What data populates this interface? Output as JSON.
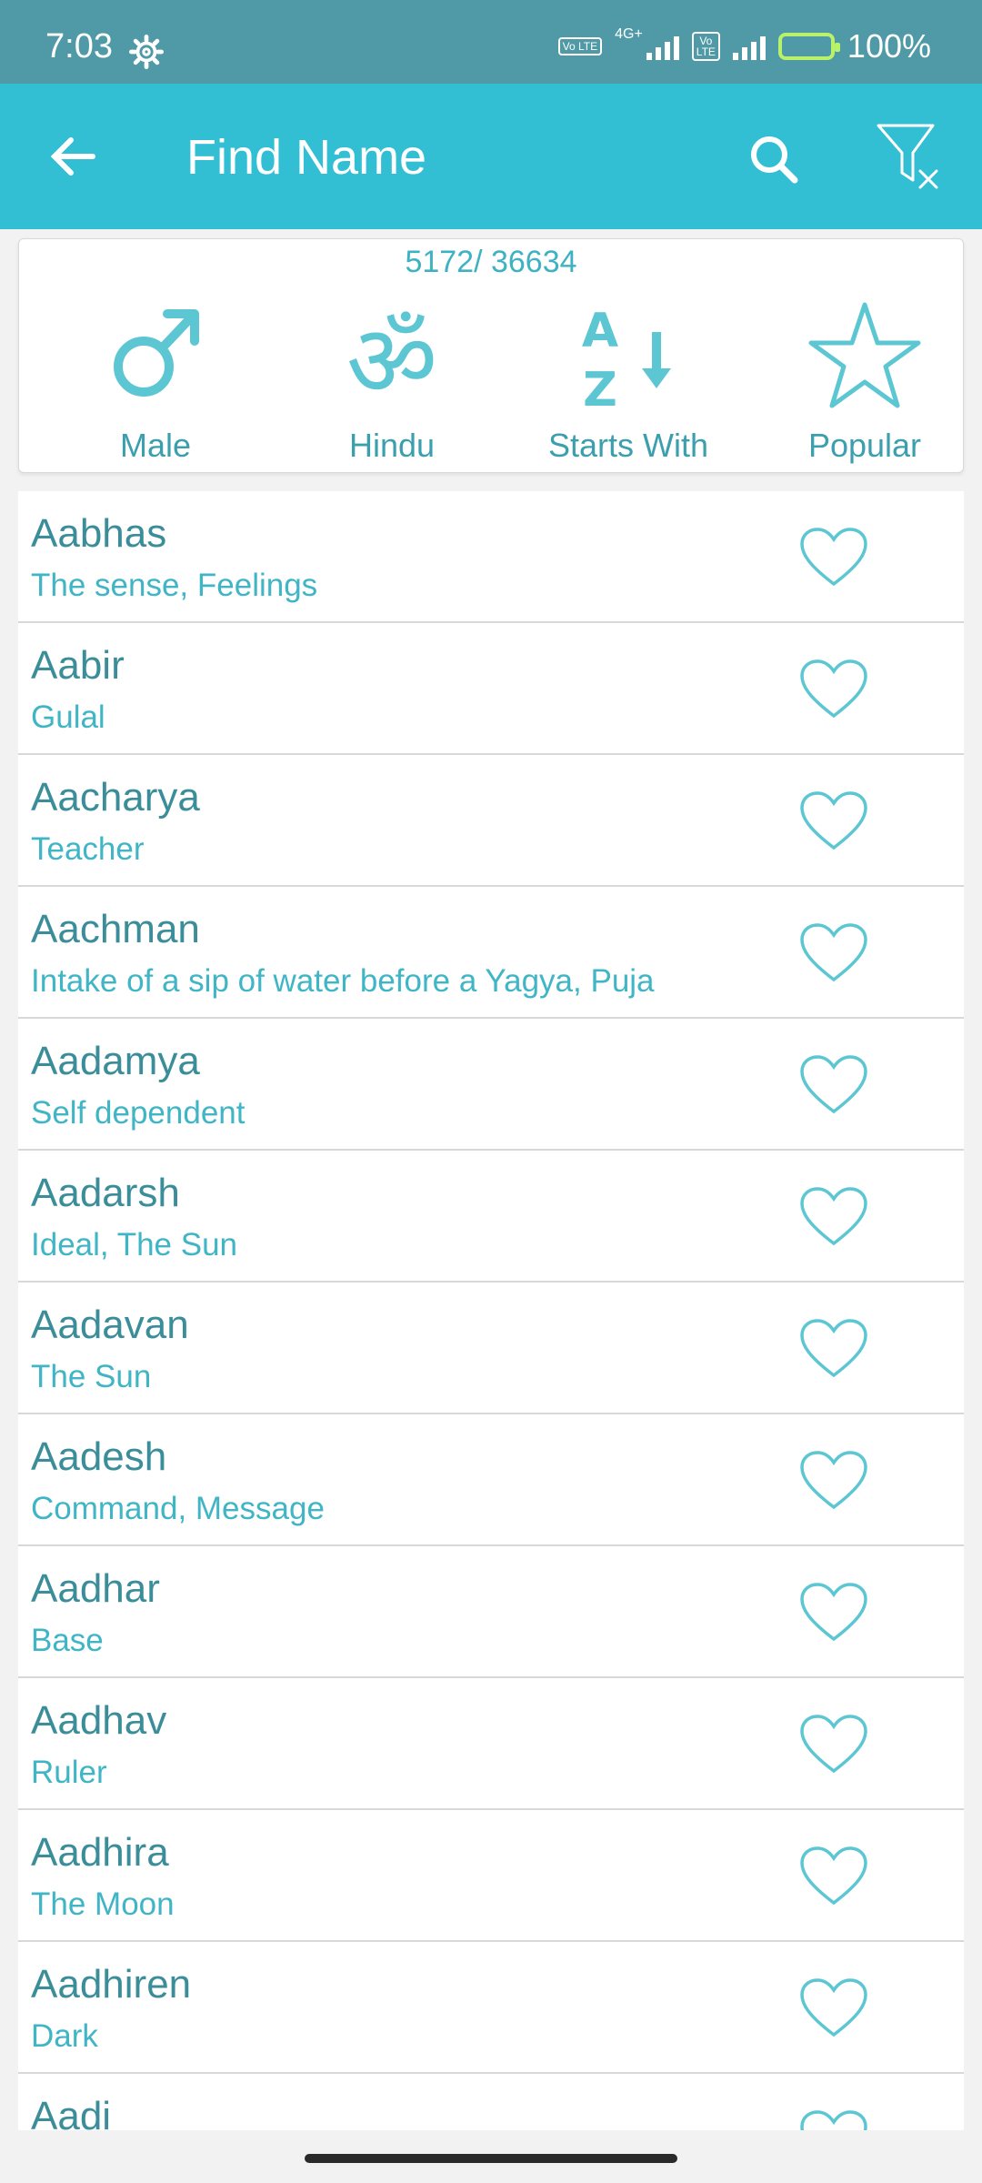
{
  "status_bar": {
    "time": "7:03",
    "network": "4G+",
    "battery": "100%",
    "volte_label": "Vo LTE"
  },
  "app_bar": {
    "title": "Find Name",
    "icons": [
      "back-arrow-icon",
      "search-icon",
      "filter-clear-icon"
    ]
  },
  "filters": {
    "count": "5172/ 36634",
    "items": [
      {
        "label": "Male",
        "icon": "male-icon"
      },
      {
        "label": "Hindu",
        "icon": "om-icon"
      },
      {
        "label": "Starts With",
        "icon": "sort-a-z-icon"
      },
      {
        "label": "Popular",
        "icon": "star-icon"
      }
    ]
  },
  "names": [
    {
      "name": "Aabhas",
      "meaning": "The sense, Feelings"
    },
    {
      "name": "Aabir",
      "meaning": "Gulal"
    },
    {
      "name": "Aacharya",
      "meaning": "Teacher"
    },
    {
      "name": "Aachman",
      "meaning": "Intake of a sip of water before a Yagya, Puja"
    },
    {
      "name": "Aadamya",
      "meaning": "Self dependent"
    },
    {
      "name": "Aadarsh",
      "meaning": "Ideal, The Sun"
    },
    {
      "name": "Aadavan",
      "meaning": "The Sun"
    },
    {
      "name": "Aadesh",
      "meaning": "Command, Message"
    },
    {
      "name": "Aadhar",
      "meaning": "Base"
    },
    {
      "name": "Aadhav",
      "meaning": "Ruler"
    },
    {
      "name": "Aadhira",
      "meaning": "The Moon"
    },
    {
      "name": "Aadhiren",
      "meaning": "Dark"
    },
    {
      "name": "Aadi",
      "meaning": ""
    }
  ],
  "colors": {
    "accent": "#33bfd3",
    "status_bar": "#4f9aa6",
    "name_text": "#3b8e99",
    "meaning_text": "#3fb5c5"
  }
}
